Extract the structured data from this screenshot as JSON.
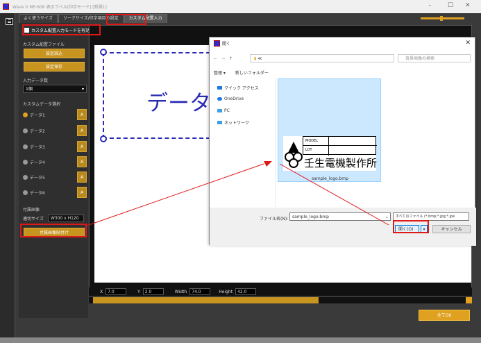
{
  "window": {
    "title": "Wave V  MP-60K  表示ラベル[印字モード] [新規1]",
    "controls": [
      "–",
      "☐",
      "✕"
    ]
  },
  "tabs": [
    "よく使うサイズ",
    "リークサイズ/印字項目の設定",
    "カスタム配置入力"
  ],
  "panel": {
    "custom_mode_label": "カスタム配置入力モードを有効にする",
    "custom_file_label": "カスタム配置ファイル",
    "load_button": "設定読込",
    "save_button": "設定保存",
    "data_count_label": "入力データ数",
    "data_count_value": "1個",
    "select_label": "カスタムデータ選択",
    "data_items": [
      "データ1",
      "データ2",
      "データ3",
      "データ4",
      "データ5",
      "データ6"
    ],
    "a_label": "A",
    "image_section_label": "付属画像",
    "size_label": "適切サイズ",
    "size_value": "W300 x H120",
    "image_button": "付属画像貼付け"
  },
  "canvas": {
    "text": "データ"
  },
  "coords": {
    "x_label": "X",
    "x_value": "7.0",
    "y_label": "Y",
    "y_value": "2.0",
    "w_label": "Width",
    "w_value": "74.0",
    "h_label": "Height",
    "h_value": "42.0"
  },
  "ok_button": "全てOK",
  "dialog": {
    "title": "開く",
    "address": "≪",
    "search_placeholder": "背景画像の検索",
    "organize": "整理 ▾",
    "new_folder": "新しいフォルダー",
    "nav": [
      "クイック アクセス",
      "OneDrive",
      "PC",
      "ネットワーク"
    ],
    "file_name": "sample_logo.bmp",
    "logo_model": "MODEL",
    "logo_lot": "LOT",
    "logo_company": "壬生電機製作所",
    "filename_label": "ファイル名(N):",
    "filename_value": "sample_logo.bmp",
    "filetype": "すべてのファイル (*.bmp;*.jpg;*.jpe",
    "open_button": "開く(O)",
    "cancel_button": "キャンセル"
  },
  "colors": {
    "accent": "#e0a020",
    "canvas_blue": "#2a2ab5",
    "highlight": "#e01818"
  }
}
